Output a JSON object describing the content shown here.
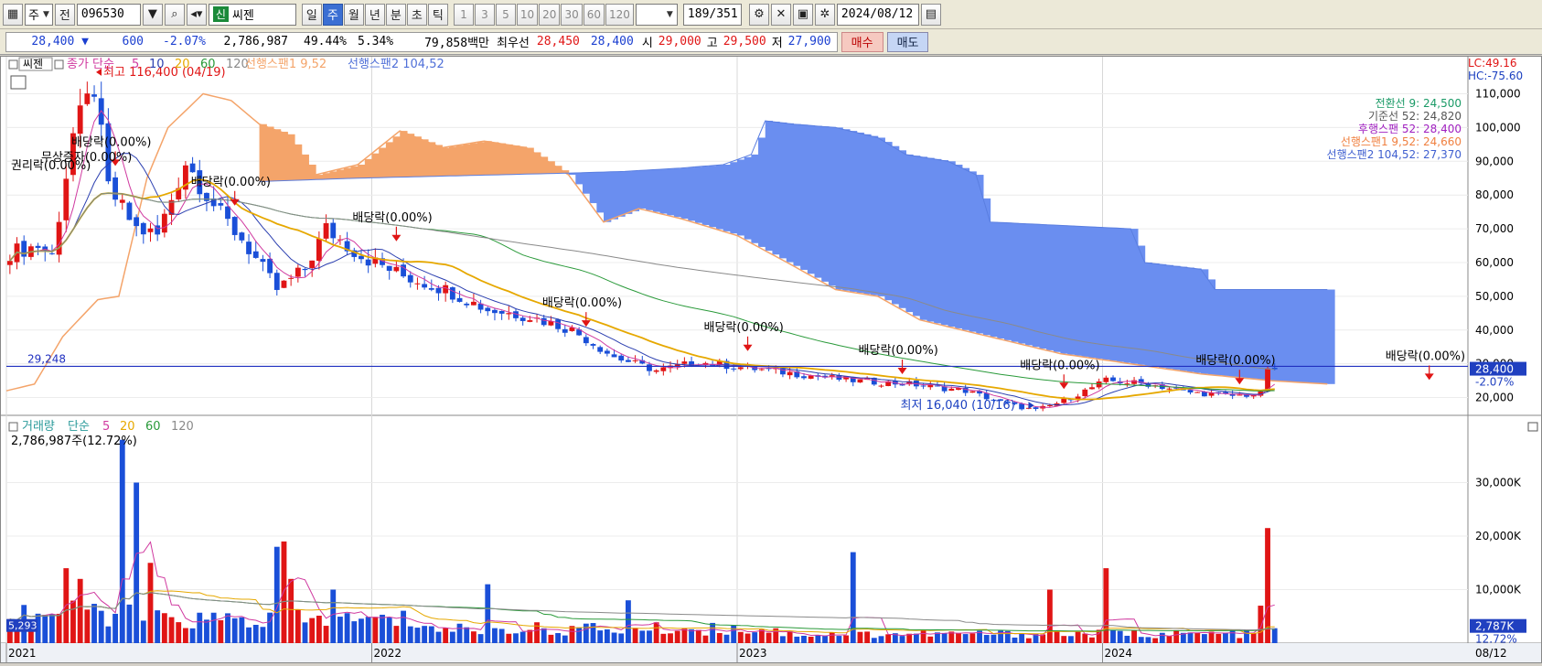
{
  "toolbar": {
    "period_type": "주",
    "prev_label": "전",
    "code": "096530",
    "stock_badge": "신",
    "stock_name": "씨젠",
    "periods": [
      "일",
      "주",
      "월",
      "년",
      "분",
      "초",
      "틱"
    ],
    "active_period": "주",
    "intervals": [
      "1",
      "3",
      "5",
      "10",
      "20",
      "30",
      "60",
      "120"
    ],
    "page_count": "189",
    "page_total": "/351",
    "date": "2024/08/12"
  },
  "quote": {
    "price": "28,400",
    "change_arrow": "▼",
    "change": "600",
    "change_pct": "-2.07%",
    "volume": "2,786,987",
    "vol_ratio": "49.44%",
    "turnover": "5.34%",
    "trade_value": "79,858백만",
    "best_label": "최우선",
    "best_ask": "28,450",
    "best_bid": "28,400",
    "open_label": "시",
    "open": "29,000",
    "high_label": "고",
    "high": "29,500",
    "low_label": "저",
    "low": "27,900",
    "buy_button": "매수",
    "sell_button": "매도"
  },
  "price_panel": {
    "title_tab": "씨젠",
    "legend_close": "종가 단순",
    "ma_periods": [
      "5",
      "10",
      "20",
      "60",
      "120"
    ],
    "span1_legend": "선행스팬1 9,52",
    "span2_legend": "선행스팬2 104,52",
    "high_annot": "최고 116,400 (04/19)",
    "low_annot": "최저 16,040 (10/16)",
    "hline_label": "29,248",
    "lc": "LC:49.16",
    "hc": "HC:-75.60",
    "ichimoku_values": [
      {
        "label": "전환선 9: 24,500",
        "color": "#1a9a66"
      },
      {
        "label": "기준선 52: 24,820",
        "color": "#555555"
      },
      {
        "label": "후행스팬 52: 28,400",
        "color": "#a020c0"
      },
      {
        "label": "선행스팬1 9,52: 24,660",
        "color": "#f08040"
      },
      {
        "label": "선행스팬2 104,52: 27,370",
        "color": "#4060d0"
      }
    ],
    "event_labels": [
      {
        "text": "배당락(0.00%)",
        "t": 15
      },
      {
        "text": "배당락(0.00%)",
        "t": 32
      },
      {
        "text": "배당락(0.00%)",
        "t": 55
      },
      {
        "text": "배당락(0.00%)",
        "t": 82
      },
      {
        "text": "배당락(0.00%)",
        "t": 105
      },
      {
        "text": "배당락(0.00%)",
        "t": 127
      },
      {
        "text": "배당락(0.00%)",
        "t": 150
      },
      {
        "text": "배당락(0.00%)",
        "t": 175
      },
      {
        "text": "배당락(0.00%)",
        "t": 202
      },
      {
        "text": "배당락(0.00%)",
        "t": 229
      },
      {
        "text": "배당락(0.00%)",
        "t": 252
      },
      {
        "text": "배당락(0.00%)",
        "t": 281
      },
      {
        "text": "배당락(0.00%)",
        "t": 297
      }
    ],
    "other_events": [
      "무상증자(0.00%)",
      "권리락(0.00%)"
    ],
    "current_price_tag": "28,400",
    "current_pct_tag": "-2.07%"
  },
  "volume_panel": {
    "legend_title": "거래량",
    "legend_type": "단순",
    "ma_periods": [
      "5",
      "20",
      "60",
      "120"
    ],
    "volume_text": "2,786,987주(12.72%)",
    "current_tag": "2,787K",
    "current_pct": "12.72%",
    "left_tag": "5,293"
  },
  "x_axis": {
    "years": [
      {
        "label": "2021",
        "t": 0
      },
      {
        "label": "2022",
        "t": 52
      },
      {
        "label": "2023",
        "t": 104
      },
      {
        "label": "2024",
        "t": 156
      }
    ],
    "end_label": "08/12"
  },
  "colors": {
    "up": "#e01515",
    "down": "#1a4fd8",
    "ma5": "#d03aa0",
    "ma10": "#2b3fb0",
    "ma20": "#e6a800",
    "ma60": "#2a9a3a",
    "ma120": "#8a8a8a",
    "cloud_bull": "#f4a46a",
    "cloud_bear": "#6a8ef0"
  },
  "chart_data": [
    {
      "type": "candlestick",
      "title": "씨젠",
      "ylim": [
        15000,
        118000
      ],
      "y_ticks": [
        20000,
        30000,
        40000,
        50000,
        60000,
        70000,
        80000,
        90000,
        100000,
        110000
      ],
      "y_tick_labels": [
        "20,000",
        "30,000",
        "40,000",
        "50,000",
        "60,000",
        "70,000",
        "80,000",
        "90,000",
        "100,000",
        "110,000"
      ],
      "x_periods": 208,
      "anchors": [
        {
          "t": 0,
          "close": 63000
        },
        {
          "t": 4,
          "close": 65000
        },
        {
          "t": 6,
          "close": 62000
        },
        {
          "t": 9,
          "close": 98000
        },
        {
          "t": 12,
          "close": 112000
        },
        {
          "t": 14,
          "close": 82000
        },
        {
          "t": 18,
          "close": 70000
        },
        {
          "t": 21,
          "close": 68000
        },
        {
          "t": 25,
          "close": 90000
        },
        {
          "t": 30,
          "close": 74000
        },
        {
          "t": 33,
          "close": 67000
        },
        {
          "t": 38,
          "close": 52000
        },
        {
          "t": 42,
          "close": 58000
        },
        {
          "t": 45,
          "close": 70000
        },
        {
          "t": 50,
          "close": 62000
        },
        {
          "t": 56,
          "close": 56000
        },
        {
          "t": 62,
          "close": 52000
        },
        {
          "t": 68,
          "close": 46000
        },
        {
          "t": 74,
          "close": 44000
        },
        {
          "t": 80,
          "close": 40000
        },
        {
          "t": 86,
          "close": 32000
        },
        {
          "t": 92,
          "close": 28000
        },
        {
          "t": 98,
          "close": 30500
        },
        {
          "t": 104,
          "close": 29000
        },
        {
          "t": 112,
          "close": 27000
        },
        {
          "t": 120,
          "close": 25000
        },
        {
          "t": 128,
          "close": 24000
        },
        {
          "t": 136,
          "close": 22000
        },
        {
          "t": 142,
          "close": 18000
        },
        {
          "t": 146,
          "close": 16200
        },
        {
          "t": 150,
          "close": 19000
        },
        {
          "t": 156,
          "close": 25000
        },
        {
          "t": 162,
          "close": 24000
        },
        {
          "t": 168,
          "close": 21500
        },
        {
          "t": 174,
          "close": 20500
        },
        {
          "t": 178,
          "close": 21000
        },
        {
          "t": 179,
          "close": 29000
        },
        {
          "t": 180,
          "close": 28400
        }
      ],
      "series": [
        {
          "name": "선행스팬1 9,52",
          "style": "cloud_top"
        },
        {
          "name": "선행스팬2 104,52",
          "style": "cloud_bottom"
        }
      ],
      "span_anchors": {
        "span1": [
          {
            "t": 0,
            "v": 22000
          },
          {
            "t": 4,
            "v": 24000
          },
          {
            "t": 8,
            "v": 38000
          },
          {
            "t": 13,
            "v": 49000
          },
          {
            "t": 16,
            "v": 50000
          },
          {
            "t": 20,
            "v": 85000
          },
          {
            "t": 23,
            "v": 100000
          },
          {
            "t": 28,
            "v": 110000
          },
          {
            "t": 32,
            "v": 108000
          },
          {
            "t": 36,
            "v": 101000
          },
          {
            "t": 40,
            "v": 98000
          },
          {
            "t": 44,
            "v": 86000
          },
          {
            "t": 50,
            "v": 89000
          },
          {
            "t": 56,
            "v": 99000
          },
          {
            "t": 62,
            "v": 94000
          },
          {
            "t": 68,
            "v": 96000
          },
          {
            "t": 74,
            "v": 94000
          },
          {
            "t": 80,
            "v": 86000
          },
          {
            "t": 85,
            "v": 72000
          },
          {
            "t": 90,
            "v": 76000
          },
          {
            "t": 96,
            "v": 73000
          },
          {
            "t": 104,
            "v": 68000
          },
          {
            "t": 112,
            "v": 59000
          },
          {
            "t": 118,
            "v": 52000
          },
          {
            "t": 124,
            "v": 50000
          },
          {
            "t": 130,
            "v": 43000
          },
          {
            "t": 140,
            "v": 38000
          },
          {
            "t": 150,
            "v": 33000
          },
          {
            "t": 160,
            "v": 30000
          },
          {
            "t": 170,
            "v": 27000
          },
          {
            "t": 180,
            "v": 25000
          },
          {
            "t": 188,
            "v": 24000
          }
        ],
        "span2": [
          {
            "t": 36,
            "v": 84000
          },
          {
            "t": 50,
            "v": 85000
          },
          {
            "t": 60,
            "v": 85500
          },
          {
            "t": 70,
            "v": 86000
          },
          {
            "t": 80,
            "v": 86500
          },
          {
            "t": 88,
            "v": 87000
          },
          {
            "t": 96,
            "v": 88000
          },
          {
            "t": 102,
            "v": 89000
          },
          {
            "t": 106,
            "v": 92000
          },
          {
            "t": 108,
            "v": 102000
          },
          {
            "t": 112,
            "v": 101000
          },
          {
            "t": 118,
            "v": 100000
          },
          {
            "t": 124,
            "v": 97000
          },
          {
            "t": 128,
            "v": 92000
          },
          {
            "t": 134,
            "v": 90000
          },
          {
            "t": 138,
            "v": 86000
          },
          {
            "t": 140,
            "v": 72000
          },
          {
            "t": 150,
            "v": 71000
          },
          {
            "t": 160,
            "v": 70000
          },
          {
            "t": 162,
            "v": 60000
          },
          {
            "t": 170,
            "v": 58000
          },
          {
            "t": 172,
            "v": 52000
          },
          {
            "t": 180,
            "v": 52000
          },
          {
            "t": 188,
            "v": 52000
          }
        ]
      }
    },
    {
      "type": "bar",
      "title": "거래량",
      "ylim": [
        0,
        40000
      ],
      "y_ticks": [
        10000,
        20000,
        30000
      ],
      "y_tick_labels": [
        "10,000K",
        "20,000K",
        "30,000K"
      ],
      "x_periods": 208,
      "unit": "K shares",
      "spikes": [
        {
          "t": 8,
          "v": 14000
        },
        {
          "t": 10,
          "v": 12000
        },
        {
          "t": 16,
          "v": 38000
        },
        {
          "t": 18,
          "v": 30000
        },
        {
          "t": 20,
          "v": 15000
        },
        {
          "t": 38,
          "v": 18000
        },
        {
          "t": 39,
          "v": 19000
        },
        {
          "t": 40,
          "v": 12000
        },
        {
          "t": 46,
          "v": 10000
        },
        {
          "t": 68,
          "v": 11000
        },
        {
          "t": 88,
          "v": 8000
        },
        {
          "t": 120,
          "v": 17000
        },
        {
          "t": 148,
          "v": 10000
        },
        {
          "t": 156,
          "v": 14000
        },
        {
          "t": 178,
          "v": 7000
        },
        {
          "t": 179,
          "v": 21500
        },
        {
          "t": 180,
          "v": 2787
        }
      ]
    }
  ]
}
